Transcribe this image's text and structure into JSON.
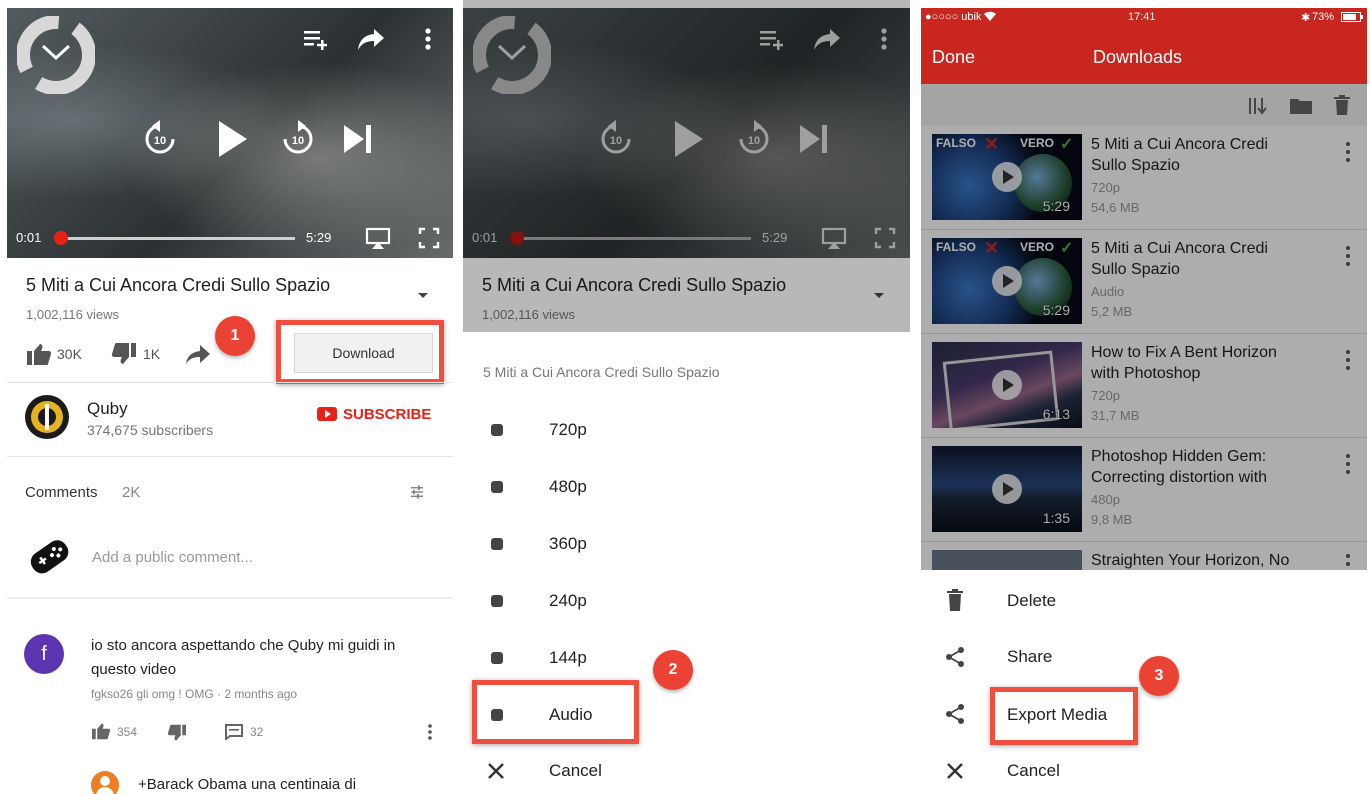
{
  "video": {
    "current_time": "0:01",
    "duration": "5:29",
    "progress": 0.003
  },
  "panel1": {
    "title": "5 Miti a Cui Ancora Credi Sullo Spazio",
    "views": "1,002,116 views",
    "likes": "30K",
    "dislikes": "1K",
    "download_label": "Download",
    "step_badge": "1",
    "channel_name": "Quby",
    "channel_subs": "374,675 subscribers",
    "subscribe_label": "SUBSCRIBE",
    "comments_label": "Comments",
    "comments_count": "2K",
    "comment_placeholder": "Add a public comment...",
    "comment": {
      "avatar_letter": "f",
      "text_line1": "io sto ancora aspettando che Quby mi guidi in",
      "text_line2": "questo video",
      "meta": "fgkso26 gli omg ! OMG · 2 months ago",
      "likes": "354",
      "replies": "32"
    },
    "reply_text": "+Barack Obama una centinaia di"
  },
  "panel2": {
    "title": "5 Miti a Cui Ancora Credi Sullo Spazio",
    "views": "1,002,116 views",
    "sheet_title": "5 Miti a Cui Ancora Credi Sullo Spazio",
    "options": [
      "720p",
      "480p",
      "360p",
      "240p",
      "144p",
      "Audio"
    ],
    "cancel_label": "Cancel",
    "step_badge": "2"
  },
  "panel3": {
    "status": {
      "carrier": "●○○○○ ubik",
      "time": "17:41",
      "battery": "73%"
    },
    "done_label": "Done",
    "header_title": "Downloads",
    "downloads": [
      {
        "title_line1": "5 Miti a Cui Ancora Credi",
        "title_line2": "Sullo Spazio",
        "quality": "720p",
        "size": "54,6 MB",
        "duration": "5:29",
        "label_left": "FALSO",
        "label_right": "VERO"
      },
      {
        "title_line1": "5 Miti a Cui Ancora Credi",
        "title_line2": "Sullo Spazio",
        "quality": "Audio",
        "size": "5,2 MB",
        "duration": "5:29",
        "label_left": "FALSO",
        "label_right": "VERO"
      },
      {
        "title_line1": "How to Fix A Bent Horizon",
        "title_line2": "with Photoshop",
        "quality": "720p",
        "size": "31,7 MB",
        "duration": "6:13"
      },
      {
        "title_line1": "Photoshop Hidden Gem:",
        "title_line2": "Correcting distortion with",
        "quality": "480p",
        "size": "9,8 MB",
        "duration": "1:35"
      },
      {
        "title_line1": "Straighten Your Horizon, No",
        "title_line2": "",
        "quality": "",
        "size": "",
        "duration": ""
      }
    ],
    "sheet": {
      "delete_label": "Delete",
      "share_label": "Share",
      "export_label": "Export Media",
      "cancel_label": "Cancel"
    },
    "step_badge": "3"
  },
  "colors": {
    "accent_red": "#e62117",
    "header_red": "#c8261f",
    "highlight": "#f04e3e"
  },
  "icons": [
    "chevron-down-icon",
    "add-to-playlist-icon",
    "share-icon",
    "more-vert-icon",
    "replay-10-icon",
    "play-icon",
    "forward-10-icon",
    "skip-next-icon",
    "airplay-icon",
    "fullscreen-icon",
    "thumb-up-icon",
    "thumb-down-icon",
    "filter-icon",
    "trash-icon",
    "close-icon",
    "sort-icon",
    "folder-icon"
  ]
}
